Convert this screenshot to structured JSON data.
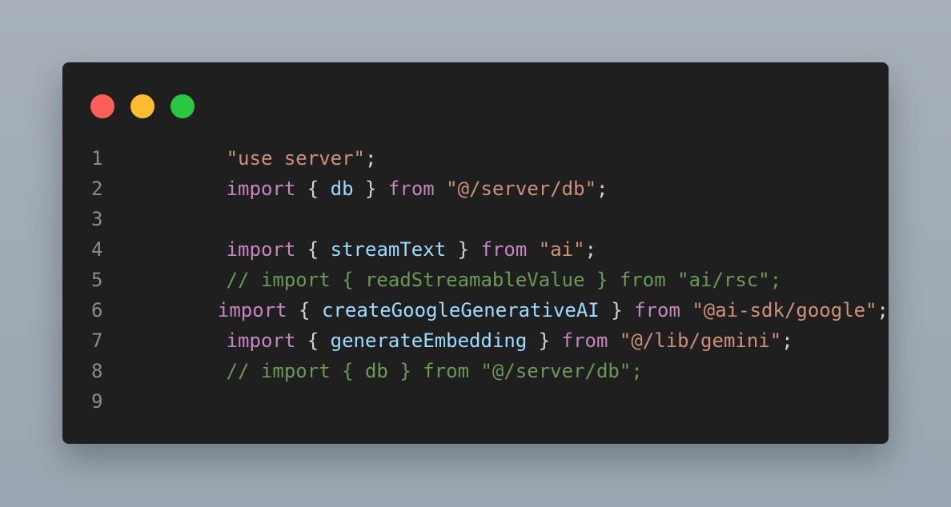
{
  "window": {
    "buttons": [
      {
        "name": "close",
        "color": "#ff5f57"
      },
      {
        "name": "minimize",
        "color": "#febc2e"
      },
      {
        "name": "maximize",
        "color": "#28c840"
      }
    ]
  },
  "code": {
    "lines": [
      {
        "number": "1",
        "tokens": [
          {
            "text": "\"use server\"",
            "color": "#ce9178"
          },
          {
            "text": ";",
            "color": "#d4d4d4"
          }
        ]
      },
      {
        "number": "2",
        "tokens": [
          {
            "text": "import",
            "color": "#c586c0"
          },
          {
            "text": " { ",
            "color": "#d4d4d4"
          },
          {
            "text": "db",
            "color": "#9cdcfe"
          },
          {
            "text": " } ",
            "color": "#d4d4d4"
          },
          {
            "text": "from",
            "color": "#c586c0"
          },
          {
            "text": " ",
            "color": "#d4d4d4"
          },
          {
            "text": "\"@/server/db\"",
            "color": "#ce9178"
          },
          {
            "text": ";",
            "color": "#d4d4d4"
          }
        ]
      },
      {
        "number": "3",
        "tokens": []
      },
      {
        "number": "4",
        "tokens": [
          {
            "text": "import",
            "color": "#c586c0"
          },
          {
            "text": " { ",
            "color": "#d4d4d4"
          },
          {
            "text": "streamText",
            "color": "#9cdcfe"
          },
          {
            "text": " } ",
            "color": "#d4d4d4"
          },
          {
            "text": "from",
            "color": "#c586c0"
          },
          {
            "text": " ",
            "color": "#d4d4d4"
          },
          {
            "text": "\"ai\"",
            "color": "#ce9178"
          },
          {
            "text": ";",
            "color": "#d4d4d4"
          }
        ]
      },
      {
        "number": "5",
        "tokens": [
          {
            "text": "// import { readStreamableValue } from \"ai/rsc\";",
            "color": "#6a9955"
          }
        ]
      },
      {
        "number": "6",
        "tokens": [
          {
            "text": "import",
            "color": "#c586c0"
          },
          {
            "text": " { ",
            "color": "#d4d4d4"
          },
          {
            "text": "createGoogleGenerativeAI",
            "color": "#9cdcfe"
          },
          {
            "text": " } ",
            "color": "#d4d4d4"
          },
          {
            "text": "from",
            "color": "#c586c0"
          },
          {
            "text": " ",
            "color": "#d4d4d4"
          },
          {
            "text": "\"@ai-sdk/google\"",
            "color": "#ce9178"
          },
          {
            "text": ";",
            "color": "#d4d4d4"
          }
        ]
      },
      {
        "number": "7",
        "tokens": [
          {
            "text": "import",
            "color": "#c586c0"
          },
          {
            "text": " { ",
            "color": "#d4d4d4"
          },
          {
            "text": "generateEmbedding",
            "color": "#9cdcfe"
          },
          {
            "text": " } ",
            "color": "#d4d4d4"
          },
          {
            "text": "from",
            "color": "#c586c0"
          },
          {
            "text": " ",
            "color": "#d4d4d4"
          },
          {
            "text": "\"@/lib/gemini\"",
            "color": "#ce9178"
          },
          {
            "text": ";",
            "color": "#d4d4d4"
          }
        ]
      },
      {
        "number": "8",
        "tokens": [
          {
            "text": "// import { db } from \"@/server/db\";",
            "color": "#6a9955"
          }
        ]
      },
      {
        "number": "9",
        "tokens": []
      }
    ]
  }
}
